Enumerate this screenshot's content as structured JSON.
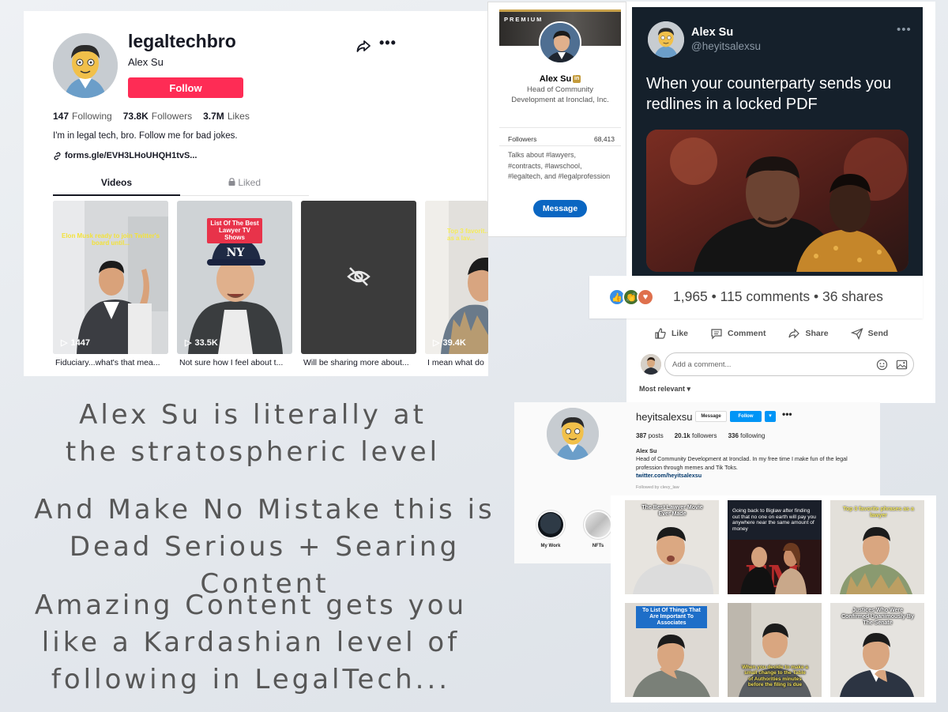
{
  "tiktok": {
    "username": "legaltechbro",
    "display_name": "Alex Su",
    "follow_label": "Follow",
    "stats": [
      {
        "value": "147",
        "label": "Following"
      },
      {
        "value": "73.8K",
        "label": "Followers"
      },
      {
        "value": "3.7M",
        "label": "Likes"
      }
    ],
    "bio": "I'm in legal tech, bro. Follow me for bad jokes.",
    "link": "forms.gle/EVH3LHoUHQH1tvS...",
    "tabs": [
      {
        "label": "Videos",
        "active": true
      },
      {
        "label": "Liked",
        "active": false
      }
    ],
    "videos": [
      {
        "overlay": "Elon Musk ready to join Twitter's board until...",
        "views": "1447",
        "caption": "Fiduciary...what's that mea..."
      },
      {
        "overlay": "List Of The Best Lawyer TV Shows",
        "views": "33.5K",
        "caption": "Not sure how I feel about t..."
      },
      {
        "overlay": "",
        "views": "",
        "caption": "Will be sharing more about..."
      },
      {
        "overlay": "Top 3 favorit... as a lav...",
        "views": "39.4K",
        "caption": "I mean what do"
      }
    ]
  },
  "slide": {
    "line1": "Alex Su is literally at the stratospheric level",
    "line2": "And Make No Mistake this is Dead Serious + Searing Content",
    "line3": "Amazing Content gets you like a Kardashian level of following in LegalTech..."
  },
  "linkedin_card": {
    "premium_label": "PREMIUM",
    "name": "Alex Su",
    "in_badge": "in",
    "headline": "Head of Community Development at Ironclad, Inc.",
    "followers_label": "Followers",
    "followers_value": "68,413",
    "talks_about": "Talks about #lawyers, #contracts, #lawschool, #legaltech, and #legalprofession",
    "message_label": "Message"
  },
  "tweet": {
    "name": "Alex Su",
    "handle": "@heyitsalexsu",
    "text": "When your counterparty sends you redlines in a locked PDF"
  },
  "linkedin_post": {
    "reactions_text": "1,965 • 115 comments • 36 shares",
    "actions": [
      "Like",
      "Comment",
      "Share",
      "Send"
    ],
    "comment_placeholder": "Add a comment...",
    "sort_label": "Most relevant ▾"
  },
  "instagram": {
    "username": "heyitsalexsu",
    "message_label": "Message",
    "follow_label": "Follow",
    "stats": [
      {
        "value": "387",
        "label": "posts"
      },
      {
        "value": "20.1k",
        "label": "followers"
      },
      {
        "value": "336",
        "label": "following"
      }
    ],
    "bio_name": "Alex Su",
    "bio_text": "Head of Community Development at Ironclad. In my free time I make fun of the legal profession through memes and Tik Toks.",
    "bio_link": "twitter.com/heyitsalexsu",
    "followed_by": "Followed by clevy_law",
    "highlights": [
      "My Work",
      "NFTs"
    ]
  },
  "grid": {
    "tiles": [
      {
        "caption": "The Best Lawyer Movie Ever Made"
      },
      {
        "caption": "Going back to Biglaw after finding out that no one on earth will pay you anywhere near the same amount of money"
      },
      {
        "caption": "Top 3 favorite phrases as a lawyer"
      },
      {
        "caption": "To List Of Things That Are Important To Associates"
      },
      {
        "caption": "When you decide to make a small change to the Table of Authorities minutes before the filing is due"
      },
      {
        "caption": "Justices Who Were Confirmed Unanimously By The Senate"
      }
    ]
  }
}
